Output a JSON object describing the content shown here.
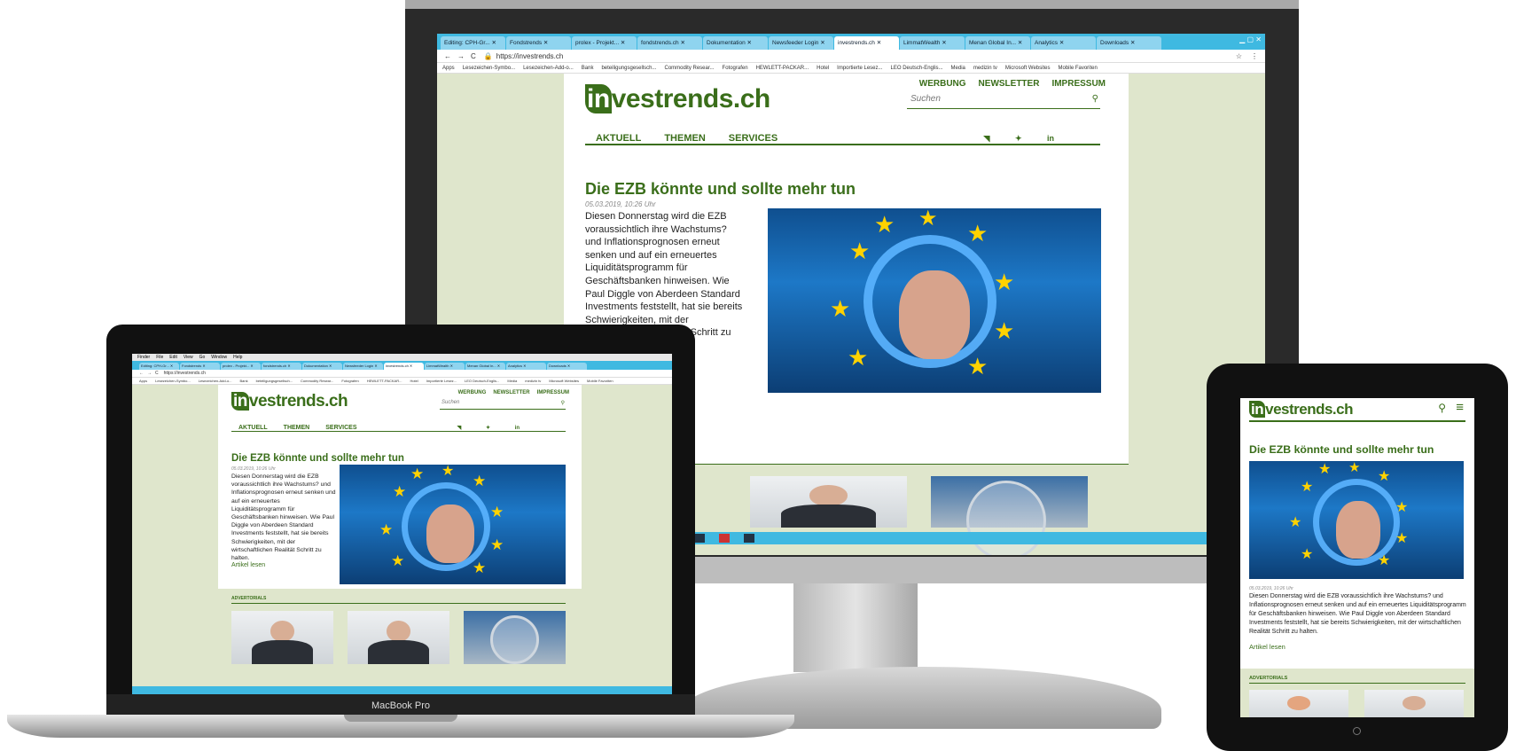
{
  "browser": {
    "tabs": [
      "Editing: CPH-Gr...",
      "Fondstrends",
      "prolex - Projekt...",
      "fondstrends.ch",
      "Dokumentation",
      "Newsfeeder Login",
      "investrends.ch",
      "LimmatWealth",
      "Menan Global In...",
      "Analytics",
      "Downloads"
    ],
    "active_tab_index": 6,
    "url": "https://investrends.ch",
    "bookmarks": [
      "Apps",
      "Lesezeichen-Symbo...",
      "Lesezeichen-Add-o...",
      "Bank",
      "beteiligungsgesellsch...",
      "Commodity Resear...",
      "Fotografen",
      "HEWLETT-PACKAR...",
      "Hotel",
      "Importierte Lesez...",
      "LEO Deutsch-Englis...",
      "Media",
      "medizin tv",
      "Microsoft Websites",
      "Mobile Favoriten"
    ]
  },
  "site": {
    "logo_in": "in",
    "logo_rest": "vestrends.ch",
    "topnav": [
      "WERBUNG",
      "NEWSLETTER",
      "IMPRESSUM"
    ],
    "search_placeholder": "Suchen",
    "mainnav": [
      "AKTUELL",
      "THEMEN",
      "SERVICES"
    ],
    "social_icons": [
      "rss-icon",
      "twitter-icon",
      "linkedin-icon"
    ],
    "article": {
      "headline": "Die EZB könnte und sollte mehr tun",
      "date": "05.03.2019, 10:26 Uhr",
      "teaser": "Diesen Donnerstag wird die EZB voraussichtlich ihre Wachstums? und Inflationsprognosen erneut senken und auf ein erneuertes Liquiditätsprogramm für Geschäftsbanken hinweisen. Wie Paul Diggle von Aberdeen Standard Investments feststellt, hat sie bereits Schwierigkeiten, mit der wirtschaftlichen Realität Schritt zu halten.",
      "read_more": "Artikel lesen"
    },
    "advertorials_label": "ADVERTORIALS"
  },
  "laptop_label": "MacBook Pro",
  "mac_menu": [
    "Finder",
    "File",
    "Edit",
    "View",
    "Go",
    "Window",
    "Help"
  ],
  "colors": {
    "brand_green": "#3a6e1a",
    "tab_blue": "#3fb9e1",
    "page_bg": "#dfe6cc"
  }
}
